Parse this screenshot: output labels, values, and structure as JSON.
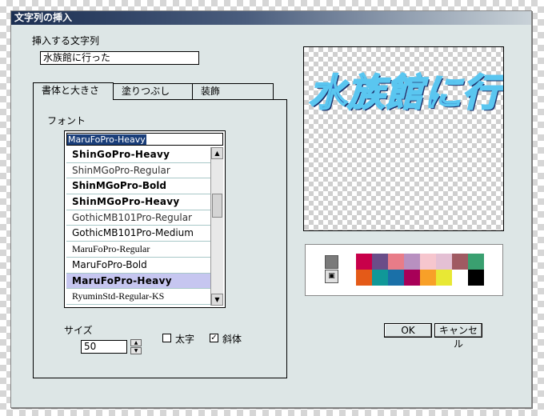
{
  "dialog": {
    "title": "文字列の挿入"
  },
  "text_section": {
    "label": "挿入する文字列",
    "value": "水族館に行った"
  },
  "tabs": [
    {
      "label": "書体と大きさ",
      "active": true
    },
    {
      "label": "塗りつぶし",
      "active": false
    },
    {
      "label": "装飾",
      "active": false
    }
  ],
  "font_section": {
    "label": "フォント",
    "current": "MaruFoPro-Heavy",
    "options": [
      {
        "name": "ShinGoPro-Heavy",
        "style": "heavy"
      },
      {
        "name": "ShinMGoPro-Regular",
        "style": "regular"
      },
      {
        "name": "ShinMGoPro-Bold",
        "style": "bold"
      },
      {
        "name": "ShinMGoPro-Heavy",
        "style": "heavy"
      },
      {
        "name": "GothicMB101Pro-Regular",
        "style": "regular"
      },
      {
        "name": "GothicMB101Pro-Medium",
        "style": "medium"
      },
      {
        "name": "MaruFoPro-Regular",
        "style": "serif"
      },
      {
        "name": "MaruFoPro-Bold",
        "style": "medium"
      },
      {
        "name": "MaruFoPro-Heavy",
        "style": "heavy",
        "selected": true
      },
      {
        "name": "RyuminStd-Regular-KS",
        "style": "serif"
      }
    ]
  },
  "size_section": {
    "label": "サイズ",
    "value": "50"
  },
  "style_options": {
    "bold": {
      "label": "太字",
      "checked": false
    },
    "italic": {
      "label": "斜体",
      "checked": true
    }
  },
  "preview": {
    "text": "水族館に行"
  },
  "palette": {
    "row1": [
      "#c8004a",
      "#6a4d88",
      "#e87c88",
      "#b890c0",
      "#f6c6ce",
      "#e4c0d4",
      "#a05a62",
      "#3aa070"
    ],
    "row2": [
      "#e45a18",
      "#109898",
      "#1a70a8",
      "#a80058",
      "#f8a028",
      "#e8e834",
      "#ffffff",
      "#000000"
    ]
  },
  "buttons": {
    "ok": "OK",
    "cancel": "キャンセル"
  }
}
